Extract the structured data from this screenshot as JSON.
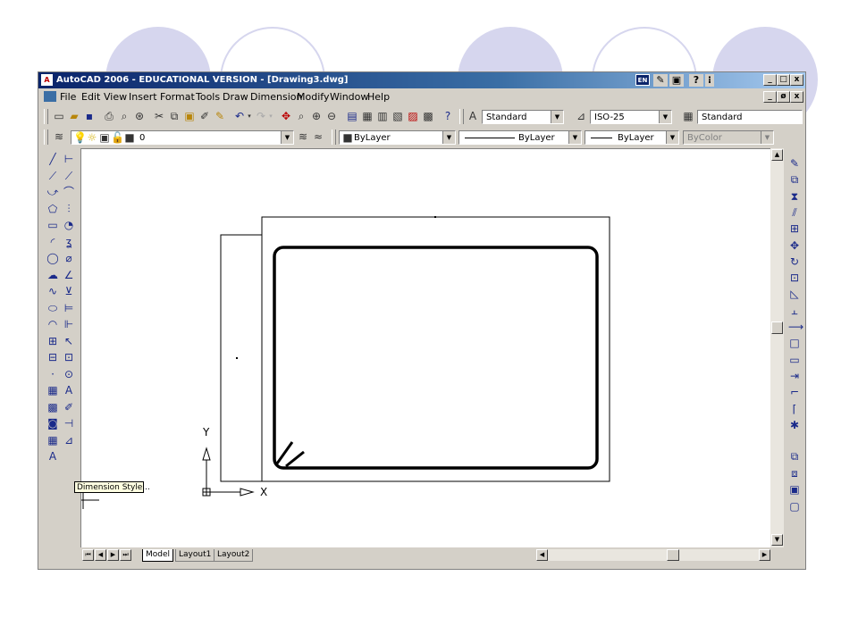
{
  "window": {
    "title": "AutoCAD 2006 - EDUCATIONAL VERSION - [Drawing3.dwg]",
    "lang_badge": "EN",
    "minimize": "_",
    "maximize": "□",
    "close": "x",
    "doc_restore": "_",
    "doc_restore2": "ø",
    "doc_close": "x"
  },
  "menu": {
    "items": [
      "File",
      "Edit",
      "View",
      "Insert",
      "Format",
      "Tools",
      "Draw",
      "Dimension",
      "Modify",
      "Window",
      "Help"
    ]
  },
  "styles_toolbar": {
    "text_style": "Standard",
    "dim_style": "ISO-25",
    "table_style": "Standard"
  },
  "layers_toolbar": {
    "layer": "0",
    "color": "ByLayer",
    "linetype": "ByLayer",
    "lineweight": "ByLayer",
    "plotstyle": "ByColor"
  },
  "tooltip": "Dimension Style...",
  "ucs": {
    "y_label": "Y",
    "x_label": "X"
  },
  "layout_tabs": [
    "Model",
    "Layout1",
    "Layout2"
  ],
  "icons": {
    "draw": [
      "line-icon",
      "construction-line-icon",
      "polyline-icon",
      "polygon-icon",
      "rectangle-icon",
      "arc-icon",
      "circle-icon",
      "revision-cloud-icon",
      "spline-icon",
      "ellipse-icon",
      "ellipse-arc-icon",
      "insert-block-icon",
      "make-block-icon",
      "point-icon",
      "hatch-icon",
      "gradient-icon",
      "region-icon",
      "table-icon",
      "multiline-text-icon"
    ],
    "dimension": [
      "linear-dimension-icon",
      "aligned-dimension-icon",
      "arc-length-icon",
      "ordinate-dimension-icon",
      "radius-dimension-icon",
      "jogged-dimension-icon",
      "diameter-dimension-icon",
      "angular-dimension-icon",
      "quick-dimension-icon",
      "baseline-dimension-icon",
      "continue-dimension-icon",
      "quick-leader-icon",
      "tolerance-icon",
      "center-mark-icon",
      "dimension-edit-icon",
      "dimension-text-edit-icon",
      "dimension-update-icon",
      "dimension-style-icon"
    ],
    "modify": [
      "erase-icon",
      "copy-icon",
      "mirror-icon",
      "offset-icon",
      "array-icon",
      "move-icon",
      "rotate-icon",
      "scale-icon",
      "stretch-icon",
      "trim-icon",
      "extend-icon",
      "break-at-point-icon",
      "break-icon",
      "join-icon",
      "chamfer-icon",
      "fillet-icon",
      "explode-icon"
    ],
    "draworder": [
      "bring-to-front-icon",
      "send-to-back-icon",
      "bring-above-icon",
      "send-under-icon"
    ]
  }
}
